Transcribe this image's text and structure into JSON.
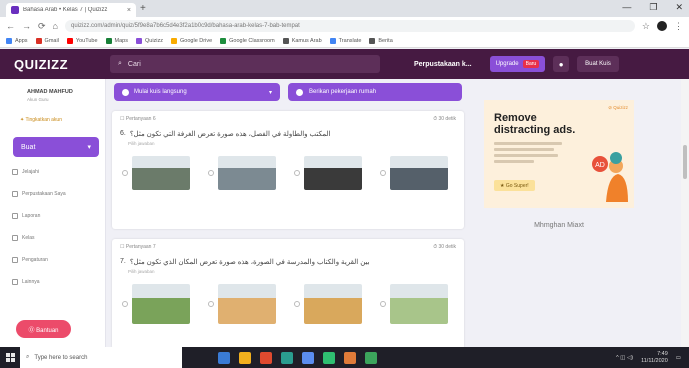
{
  "browser": {
    "tab_title": "Bahasa Arab • Kelas 7 | Quizizz",
    "tab_close": "×",
    "new_tab": "+",
    "window_controls": [
      "—",
      "❐",
      "✕"
    ],
    "nav": [
      "←",
      "→",
      "⟳",
      "⌂"
    ],
    "url": "quizizz.com/admin/quiz/5f9e8a7b6c5d4e3f2a1b0c9d/bahasa-arab-kelas-7-bab-tempat",
    "bookmarks": [
      {
        "label": "Apps",
        "color": "#4285f4"
      },
      {
        "label": "Gmail",
        "color": "#d93025"
      },
      {
        "label": "YouTube",
        "color": "#ff0000"
      },
      {
        "label": "Maps",
        "color": "#188038"
      },
      {
        "label": "Quizizz",
        "color": "#8a4fd8"
      },
      {
        "label": "Google Drive",
        "color": "#f9ab00"
      },
      {
        "label": "Google Classroom",
        "color": "#1e8e3e"
      },
      {
        "label": "Kamus Arab",
        "color": "#555555"
      },
      {
        "label": "Translate",
        "color": "#4285f4"
      },
      {
        "label": "Berita",
        "color": "#555555"
      }
    ]
  },
  "header": {
    "logo": "QUIZIZZ",
    "search_icon": "search-icon",
    "search_placeholder": "Cari",
    "library": "Perpustakaan k...",
    "upgrade_label": "Upgrade",
    "upgrade_badge": "Baru",
    "bell_glyph": "●",
    "create_label": "Buat Kuis"
  },
  "sidebar": {
    "user_name": "AHMAD MAHFUD",
    "user_sub": "Akun Guru",
    "upgrade_link": "✦ Tingkatkan akun",
    "create_button": "Buat",
    "create_caret": "▾",
    "nav_items": [
      "Jelajahi",
      "Perpustakaan Saya",
      "Laporan",
      "Kelas",
      "Pengaturan",
      "Lainnya"
    ],
    "help_button": "⓪ Bantuan"
  },
  "main": {
    "action_live": "Mulai kuis langsung",
    "action_live_caret": "▾",
    "action_homework": "Berikan pekerjaan rumah",
    "questions": [
      {
        "label": "☐ Pertanyaan 6",
        "time": "⏱ 30 detik",
        "number": "6.",
        "text": "المكتب والطاولة في الفصل، هذه صورة تعرض الغرفة التي تكون مثل؟",
        "sub": "Pilih jawaban",
        "options": [
          {
            "color": "#6b7b6a"
          },
          {
            "color": "#7c8a92"
          },
          {
            "color": "#3a3a3a"
          },
          {
            "color": "#55606a"
          }
        ]
      },
      {
        "label": "☐ Pertanyaan 7",
        "time": "⏱ 30 detik",
        "number": "7.",
        "text": "بين القرية والكتاب والمدرسة في الصورة، هذه صورة تعرض المكان الذي تكون مثل؟",
        "sub": "Pilih jawaban",
        "options": [
          {
            "color": "#7aa35a"
          },
          {
            "color": "#e0b070"
          },
          {
            "color": "#d9a85c"
          },
          {
            "color": "#a8c58a"
          }
        ]
      }
    ]
  },
  "ad": {
    "corner": "⊘ Quizizz",
    "title_line1": "Remove",
    "title_line2": "distracting ads.",
    "cta": "★ Go Super!",
    "membership": "Mhmghan Miaxt"
  },
  "taskbar": {
    "search_placeholder": "Type here to search",
    "apps": [
      "#3a7bd5",
      "#f2b01e",
      "#e04a2f",
      "#2a9d8f",
      "#5b8def",
      "#2fbf71",
      "#e07b39",
      "#3ca55c"
    ],
    "tray_icons": "^  ◫  ◁)",
    "time": "7:49",
    "date": "11/11/2020"
  }
}
